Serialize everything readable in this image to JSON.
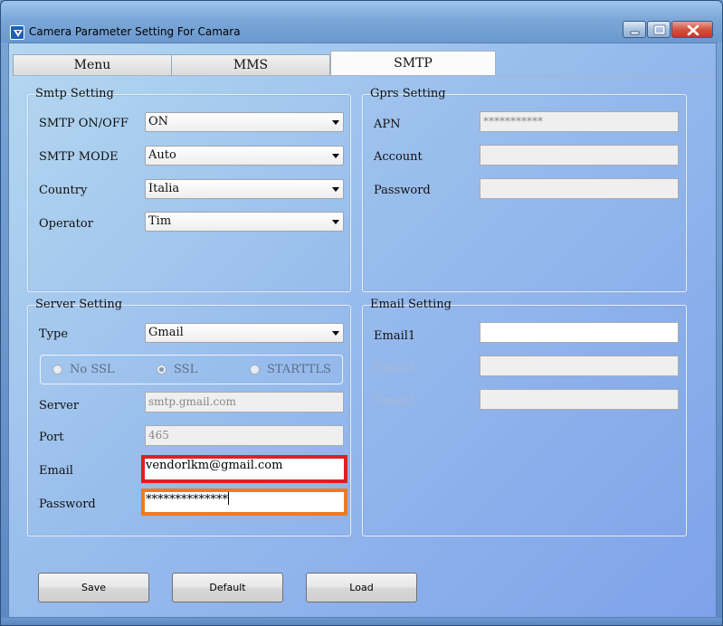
{
  "window": {
    "title": "Camera Parameter Setting For  Camara",
    "icon": "camera-app-icon",
    "controls": [
      "minimize-icon",
      "maximize-icon",
      "close-icon"
    ]
  },
  "tabs": [
    {
      "label": "Menu",
      "active": false
    },
    {
      "label": "MMS",
      "active": false
    },
    {
      "label": "SMTP",
      "active": true
    }
  ],
  "smtp_setting": {
    "title": "Smtp Setting",
    "on_off": {
      "label": "SMTP ON/OFF",
      "value": "ON"
    },
    "mode": {
      "label": "SMTP MODE",
      "value": "Auto"
    },
    "country": {
      "label": "Country",
      "value": "Italia"
    },
    "operator": {
      "label": "Operator",
      "value": "Tim"
    }
  },
  "gprs_setting": {
    "title": "Gprs Setting",
    "apn": {
      "label": "APN",
      "value": "***********"
    },
    "account": {
      "label": "Account",
      "value": ""
    },
    "password": {
      "label": "Password",
      "value": ""
    }
  },
  "server_setting": {
    "title": "Server Setting",
    "type": {
      "label": "Type",
      "value": "Gmail"
    },
    "ssl_options": [
      {
        "label": "No SSL",
        "checked": false
      },
      {
        "label": "SSL",
        "checked": true
      },
      {
        "label": "STARTTLS",
        "checked": false
      }
    ],
    "server": {
      "label": "Server",
      "value": "smtp.gmail.com"
    },
    "port": {
      "label": "Port",
      "value": "465"
    },
    "email": {
      "label": "Email",
      "value": "vendorlkm@gmail.com"
    },
    "password": {
      "label": "Password",
      "value": "**************"
    }
  },
  "email_setting": {
    "title": "Email Setting",
    "email1": {
      "label": "Email1",
      "value": ""
    },
    "email2": {
      "label": "Email2",
      "value": ""
    },
    "email3": {
      "label": "Email3",
      "value": ""
    }
  },
  "buttons": {
    "save": "Save",
    "default": "Default",
    "load": "Load"
  },
  "colors": {
    "email_highlight": "#e21d24",
    "password_highlight": "#ee7a24"
  }
}
